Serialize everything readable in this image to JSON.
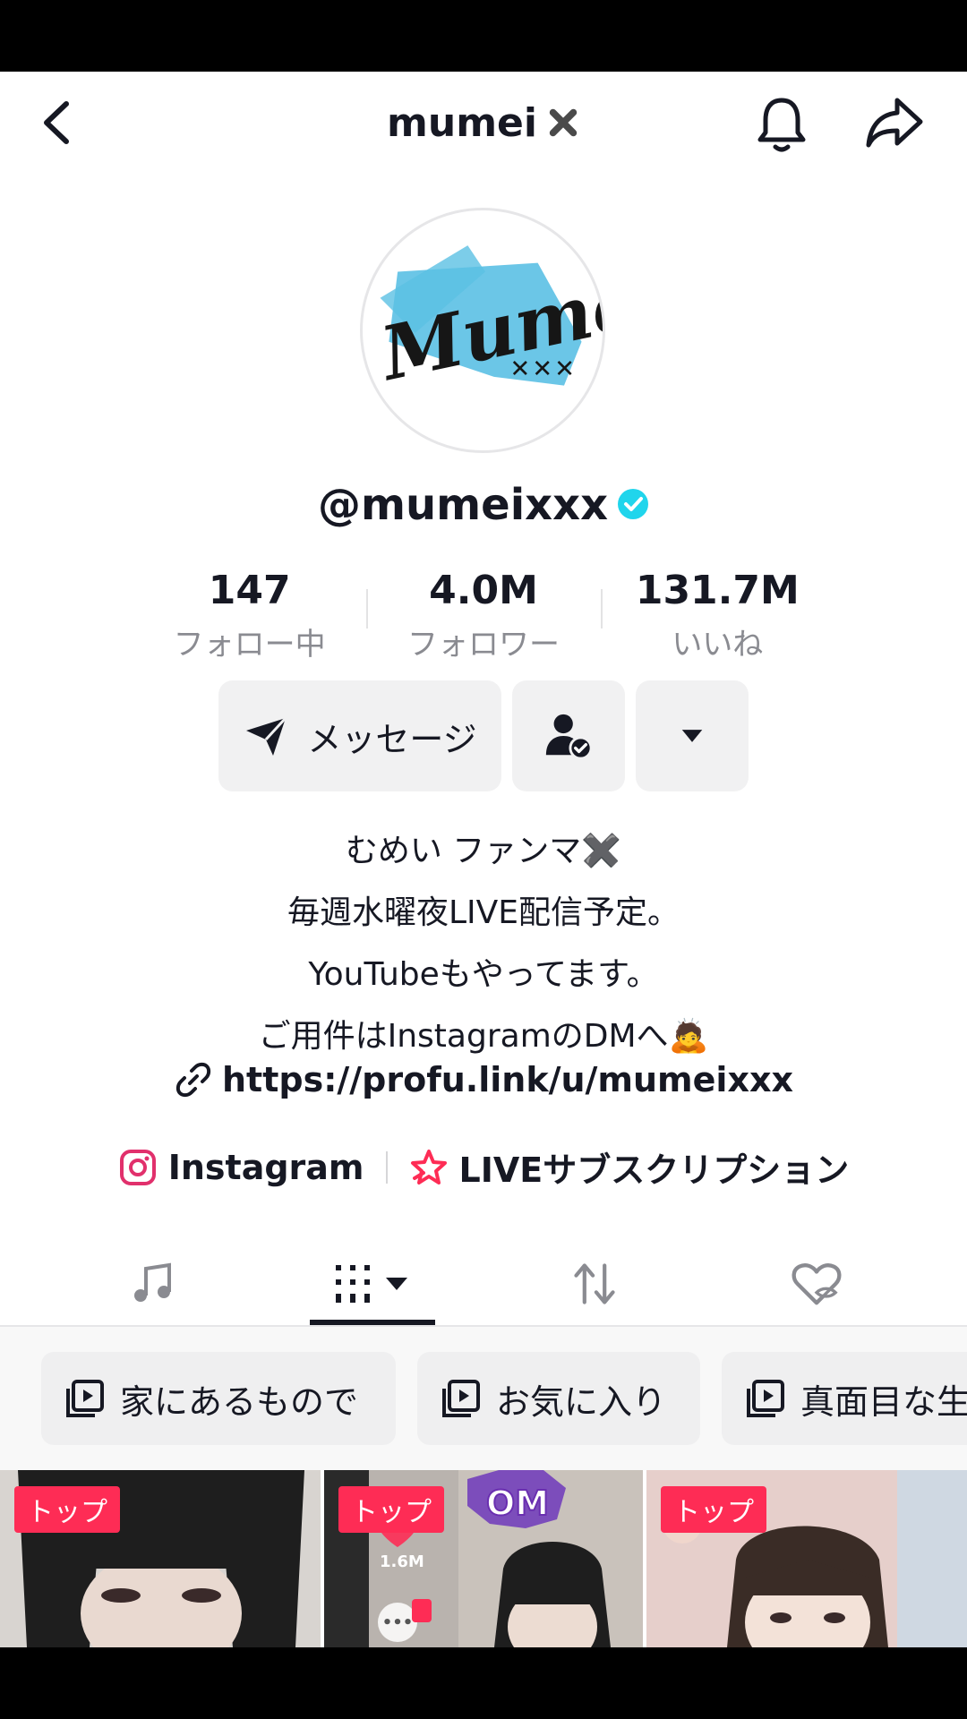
{
  "header": {
    "title": "mumei"
  },
  "avatar": {
    "logo_text": "Mumei",
    "logo_subtext": "XXX"
  },
  "profile": {
    "handle": "@mumeixxx"
  },
  "stats": [
    {
      "value": "147",
      "label": "フォロー中"
    },
    {
      "value": "4.0M",
      "label": "フォロワー"
    },
    {
      "value": "131.7M",
      "label": "いいね"
    }
  ],
  "actions": {
    "message_label": "メッセージ"
  },
  "bio": {
    "lines": [
      "むめい ファンマ✖️",
      "毎週水曜夜LIVE配信予定。",
      "YouTubeもやってます。",
      "ご用件はInstagramのDMへ🙇"
    ],
    "link": "https://profu.link/u/mumeixxx"
  },
  "social": {
    "instagram": "Instagram",
    "subscription": "LIVEサブスクリプション"
  },
  "playlists": [
    "家にあるもので",
    "お気に入り",
    "真面目な生"
  ],
  "videos": [
    {
      "badge": "トップ"
    },
    {
      "badge": "トップ",
      "likes": "1.6M",
      "sticker": "OM"
    },
    {
      "badge": "トップ"
    }
  ],
  "colors": {
    "accent": "#fe2c55",
    "verified": "#20d5ec",
    "instagram": "#e1306c"
  }
}
